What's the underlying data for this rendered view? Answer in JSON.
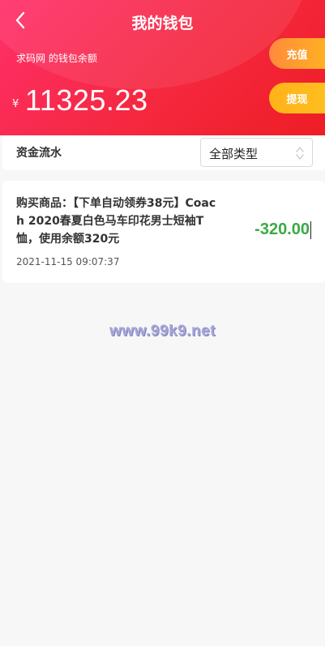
{
  "header": {
    "title": "我的钱包",
    "balance_label": "求码网 的钱包余额",
    "currency_symbol": "¥",
    "balance_amount": "11325.23",
    "recharge_label": "充值",
    "withdraw_label": "提现"
  },
  "filter": {
    "label": "资金流水",
    "selected_type": "全部类型"
  },
  "records": [
    {
      "description": "购买商品：【下单自动领券38元】Coach 2020春夏白色马车印花男士短袖T恤，使用余额320元",
      "time": "2021-11-15 09:07:37",
      "amount": "-320.00"
    }
  ],
  "watermark": "www.99k9.net",
  "colors": {
    "header_gradient_start": "#ff2f6a",
    "header_gradient_end": "#ee1d25",
    "recharge_button": "#ff9a2e",
    "withdraw_button": "#ffb81c",
    "negative_amount": "#3aaa45"
  },
  "icons": {
    "back": "chevron-left-icon",
    "select": "up-down-arrows-icon"
  }
}
